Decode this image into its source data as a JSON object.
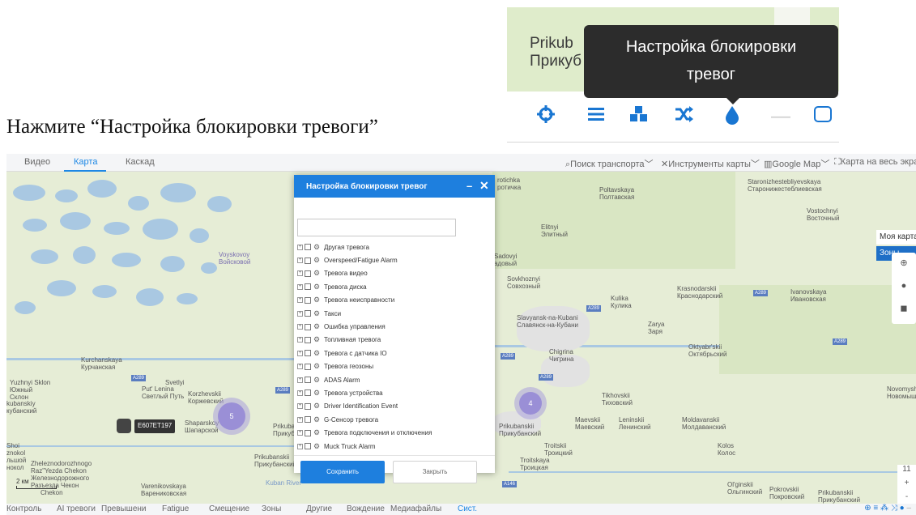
{
  "instruction": "Нажмите “Настройка блокировки тревоги”",
  "inset": {
    "town_latin": "Prikub",
    "town_cyr": "Прикуб",
    "tooltip_line1": "Настройка блокировки",
    "tooltip_line2": "тревог"
  },
  "topnav": {
    "tabs": [
      "Видео",
      "Карта",
      "Каскад"
    ],
    "active_tab": "Карта",
    "tools": [
      "Поиск транспорта",
      "Инструменты карты",
      "Google Map",
      "Карта на весь экран"
    ]
  },
  "map_labels": {
    "voyskovoy": "Voyskovoy",
    "voyskovoy_cyr": "Войсковой",
    "kurchanskaya": "Kurchanskaya",
    "kurchanskaya_cyr": "Курчанская",
    "yuzhnyi": "Yuzhnyi Sklon",
    "yuzhnyi_cyr1": "Южный",
    "yuzhnyi_cyr2": "Склон",
    "svetlyi": "Svetlyi",
    "svetlyi2": "Put' Lenina",
    "svetlyi_cyr": "Светлый Путь",
    "korzhevskii": "Korzhevskii",
    "korzhevskii_cyr": "Коржевский",
    "shaparskoy": "Shaparskoy",
    "shaparskoy_cyr": "Шапарской",
    "kubanskiy": "kubanskiy",
    "kubanskiy_cyr": "кубанский",
    "prikuba": "Prikuba",
    "prikuba_cyr": "Прикуба",
    "prikubanskii1": "Prikubanskii",
    "prikubanskii1_cyr": "Прикубанский",
    "zheleznodorozhnogo": "Zheleznodorozhnogo",
    "raz_yezda": "Raz\"Yezda Chekon",
    "zhel_cyr": "Железнодорожного",
    "raz_cyr": "Разъезда Чекон",
    "chekon": "Chekon",
    "varenikovskaya": "Varenikovskaya",
    "varenikovskaya_cyr": "Варениковская",
    "shoi": "Shoi",
    "znokol": "znokol",
    "lshoi": "льшой",
    "nokol": "нокол",
    "protichka": "rotichka",
    "protichka_cyr": "ротичка",
    "poltavskaya": "Poltavskaya",
    "poltavskaya_cyr": "Полтавская",
    "elitnyi": "Elitnyi",
    "elitnyi_cyr": "Элитный",
    "sadovyi": "Sadovyi",
    "sadovyi_cyr": "адовый",
    "sovkhoznyi": "Sovkhoznyi",
    "sovkhoznyi_cyr": "Совхозный",
    "kulika": "Kulika",
    "kulika_cyr": "Кулика",
    "krasnodarskii": "Krasnodarskii",
    "krasnodarskii_cyr": "Краснодарский",
    "ivanovskaya": "Ivanovskaya",
    "ivanovskaya_cyr": "Ивановская",
    "slavyansk": "Slavyansk-na-Kubani",
    "slavyansk_cyr": "Славянск-на-Кубани",
    "zarya": "Zarya",
    "zarya_cyr": "Заря",
    "oktyabrskii": "Oktyabr'skii",
    "oktyabrskii_cyr": "Октябрьский",
    "chigrina": "Chigrina",
    "chigrina_cyr": "Чигрина",
    "staroniz": "Staronizhestebliyevskaya",
    "staroniz_cyr": "Старонижестеблиевская",
    "vostochnyi": "Vostochnyi",
    "vostochnyi_cyr": "Восточный",
    "tikhovskii": "Tikhovskii",
    "tikhovskii_cyr": "Тиховский",
    "novomysh": "Novomyshas",
    "novomysh_cyr": "Новомышас",
    "prikubanskii2": "Prikubanskii",
    "prikubanskii2_cyr": "Прикубанский",
    "maevskii": "Maevskii",
    "maevskii_cyr": "Маевский",
    "leninskii": "Leninskii",
    "leninskii_cyr": "Ленинский",
    "moldavanskii": "Moldavanskii",
    "moldavanskii_cyr": "Молдаванский",
    "troitskii": "Troitskii",
    "troitskii_cyr": "Троицкий",
    "troitskaya": "Troitskaya",
    "troitskaya_cyr": "Троицкая",
    "kolos": "Kolos",
    "kolos_cyr": "Колос",
    "olginskii": "Ol'ginskii",
    "olginskii_cyr": "Ольгинский",
    "pokrovskii": "Pokrovskii",
    "pokrovskii_cyr": "Покровский",
    "prikubanskii3": "Prikubanskii",
    "prikubanskii3_cyr": "Прикубанский",
    "kuban_river": "Kuban River"
  },
  "road_shields": [
    "A289",
    "A289",
    "A289",
    "A289",
    "A289",
    "A289",
    "A289",
    "A146"
  ],
  "clusters": [
    "5",
    "4"
  ],
  "vehicle_plate": "E607EТ197",
  "scale_label": "2 км",
  "right_panel": {
    "title": "Моя карта",
    "tab": "Зоны"
  },
  "zoom": {
    "level": "11",
    "plus": "+",
    "minus": "-"
  },
  "bottom_tabs": [
    "Контроль",
    "AI тревоги",
    "Превышени",
    "Fatigue",
    "Смещение",
    "Зоны",
    "Другие",
    "Вождение",
    "Медиафайлы",
    "Сист."
  ],
  "bottom_active": "Сист.",
  "dialog": {
    "title": "Настройка блокировки тревог",
    "minimize": "–",
    "close": "✕",
    "search_value": "",
    "items": [
      "Другая тревога",
      "Overspeed/Fatigue Alarm",
      "Тревога видео",
      "Тревога диска",
      "Тревога неисправности",
      "Такси",
      "Ошибка управления",
      "Топливная тревога",
      "Тревога с датчика IO",
      "Тревога геозоны",
      "ADAS Alarm",
      "Тревога устройства",
      "Driver Identification Event",
      "G-Сенсор тревога",
      "Тревога подключения и отключения",
      "Muck Truck Alarm"
    ],
    "save_label": "Сохранить",
    "close_label": "Закрыть"
  },
  "colors": {
    "accent": "#1e7fde",
    "map_bg": "#e6edd6",
    "water": "#a9c8e2",
    "tooltip_bg": "#2c2c2c"
  }
}
